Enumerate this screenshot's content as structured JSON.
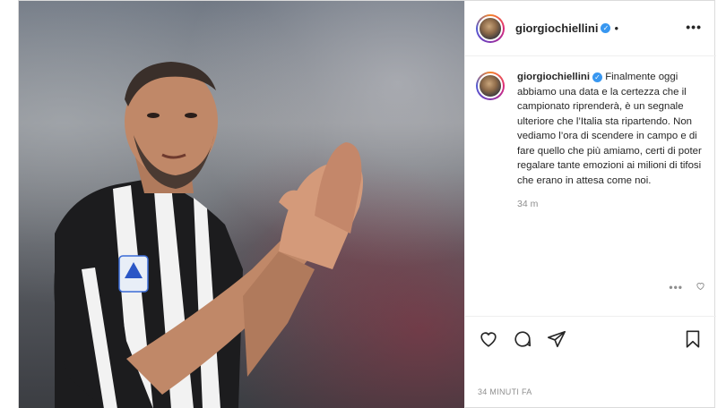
{
  "post": {
    "username": "giorgiochiellini",
    "verified_icon": "verified-badge-icon",
    "separator": "•",
    "more_label": "•••",
    "caption": "Finalmente oggi abbiamo una data e la certezza che il campionato riprenderà, è un segnale ulteriore che l’Italia sta ripartendo. Non vediamo l’ora di scendere in campo e di fare quello che più amiamo, certi di poter regalare tante emozioni ai milioni di tifosi che erano in attesa come noi.",
    "caption_time": "34 m",
    "comment_more_label": "•••",
    "timestamp": "34 MINUTI FA",
    "icons": {
      "like": "heart-icon",
      "comment": "comment-icon",
      "share": "share-icon",
      "save": "bookmark-icon"
    },
    "colors": {
      "verified": "#3897f0",
      "muted_text": "#8e8e8e",
      "border": "#dbdbdb"
    }
  }
}
